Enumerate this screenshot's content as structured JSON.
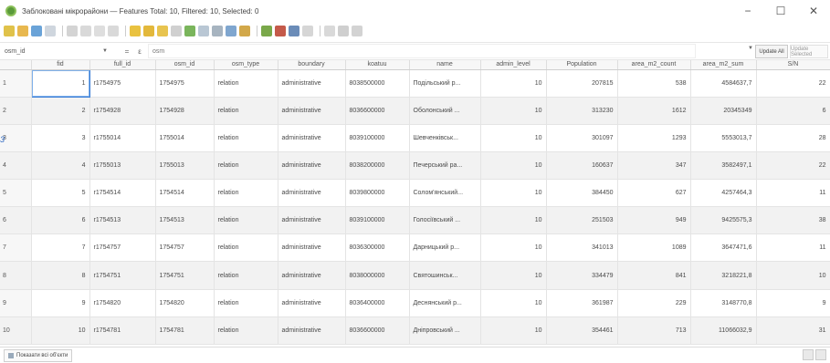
{
  "window": {
    "title": "Заблоковані мікрорайони — Features Total: 10, Filtered: 10, Selected: 0",
    "controls": {
      "minimize": "−",
      "maximize": "☐",
      "close": "✕"
    }
  },
  "filter": {
    "field": "osm_id",
    "expression": "osm",
    "update_label": "Update All",
    "update_selected_label": "Update Selected"
  },
  "table": {
    "columns": [
      "fid",
      "full_id",
      "osm_id",
      "osm_type",
      "boundary",
      "koatuu",
      "name",
      "admin_level",
      "Population",
      "area_m2_count",
      "area_m2_sum",
      "S/N"
    ],
    "rows": [
      {
        "n": "1",
        "cells": [
          "1",
          "r1754975",
          "1754975",
          "relation",
          "administrative",
          "8038500000",
          "Подільський р...",
          "10",
          "207815",
          "538",
          "4584637,7",
          "22"
        ]
      },
      {
        "n": "2",
        "cells": [
          "2",
          "r1754928",
          "1754928",
          "relation",
          "administrative",
          "8036600000",
          "Оболонський ...",
          "10",
          "313230",
          "1612",
          "20345349",
          "6"
        ]
      },
      {
        "n": "3",
        "cells": [
          "3",
          "r1755014",
          "1755014",
          "relation",
          "administrative",
          "8039100000",
          "Шевченківськ...",
          "10",
          "301097",
          "1293",
          "5553013,7",
          "28"
        ]
      },
      {
        "n": "4",
        "cells": [
          "4",
          "r1755013",
          "1755013",
          "relation",
          "administrative",
          "8038200000",
          "Печерський ра...",
          "10",
          "160637",
          "347",
          "3582497,1",
          "22"
        ]
      },
      {
        "n": "5",
        "cells": [
          "5",
          "r1754514",
          "1754514",
          "relation",
          "administrative",
          "8039800000",
          "Солом'янський...",
          "10",
          "384450",
          "627",
          "4257464,3",
          "11"
        ]
      },
      {
        "n": "6",
        "cells": [
          "6",
          "r1754513",
          "1754513",
          "relation",
          "administrative",
          "8039100000",
          "Голосіївський ...",
          "10",
          "251503",
          "949",
          "9425575,3",
          "38"
        ]
      },
      {
        "n": "7",
        "cells": [
          "7",
          "r1754757",
          "1754757",
          "relation",
          "administrative",
          "8036300000",
          "Дарницький р...",
          "10",
          "341013",
          "1089",
          "3647471,6",
          "11"
        ]
      },
      {
        "n": "8",
        "cells": [
          "8",
          "r1754751",
          "1754751",
          "relation",
          "administrative",
          "8038000000",
          "Святошинськ...",
          "10",
          "334479",
          "841",
          "3218221,8",
          "10"
        ]
      },
      {
        "n": "9",
        "cells": [
          "9",
          "r1754820",
          "1754820",
          "relation",
          "administrative",
          "8036400000",
          "Деснянський р...",
          "10",
          "361987",
          "229",
          "3148770,8",
          "9"
        ]
      },
      {
        "n": "10",
        "cells": [
          "10",
          "r1754781",
          "1754781",
          "relation",
          "administrative",
          "8036600000",
          "Дніпровський ...",
          "10",
          "354461",
          "713",
          "11066032,9",
          "31"
        ]
      }
    ]
  },
  "side_mark": "3",
  "status": {
    "show_features": "Показати всі об'єкти"
  },
  "icons": [
    "pencil-icon",
    "save-icon",
    "reload-icon",
    "add-feature-icon",
    "delete-icon",
    "cut-icon",
    "copy-icon",
    "paste-icon",
    "expression-select-icon",
    "select-all-icon",
    "invert-selection-icon",
    "deselect-icon",
    "filter-icon",
    "move-top-icon",
    "pan-icon",
    "zoom-icon",
    "copy-rows-icon",
    "new-field-icon",
    "delete-field-icon",
    "field-calculator-icon",
    "conditional-format-icon",
    "dock-icon",
    "actions-icon",
    "help-icon"
  ],
  "colors": {
    "selection_border": "#3b7ed6",
    "alt_row": "#f2f2f2"
  }
}
